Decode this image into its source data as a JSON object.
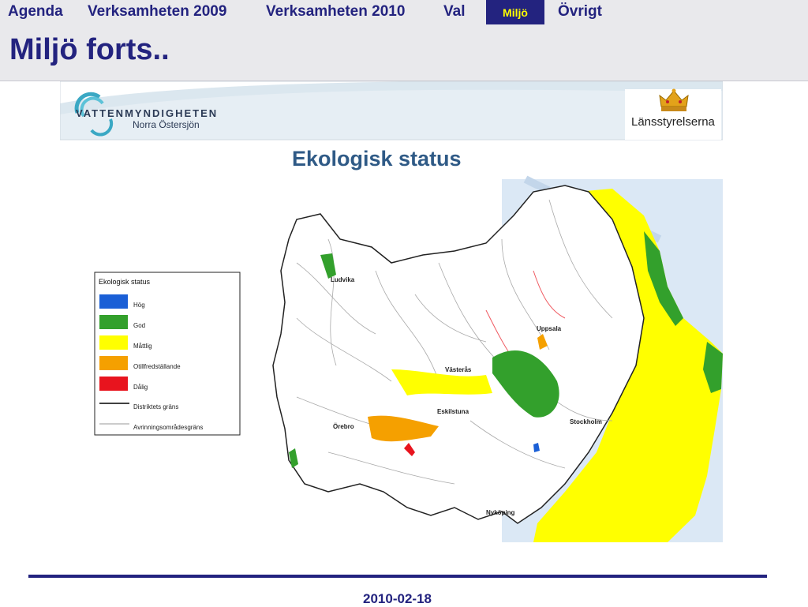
{
  "nav": {
    "items": [
      {
        "label": "Agenda"
      },
      {
        "label": "Verksamheten 2009"
      },
      {
        "label": "Verksamheten 2010"
      },
      {
        "label": "Val"
      },
      {
        "label": "Miljö",
        "active": true
      },
      {
        "label": "Övrigt"
      }
    ]
  },
  "page": {
    "title": "Miljö forts.."
  },
  "slide": {
    "logo_left_line1": "VATTENMYNDIGHETEN",
    "logo_left_line2": "Norra Östersjön",
    "logo_right": "Länsstyrelserna",
    "map_title": "Ekologisk status",
    "legend": {
      "title": "Ekologisk status",
      "items": [
        {
          "label": "Hög",
          "color": "#1a5fd6"
        },
        {
          "label": "God",
          "color": "#33a02c"
        },
        {
          "label": "Måttlig",
          "color": "#ffff00"
        },
        {
          "label": "Otillfredställande",
          "color": "#f5a000"
        },
        {
          "label": "Dålig",
          "color": "#e8141e"
        }
      ],
      "lines": [
        {
          "label": "Distriktets gräns"
        },
        {
          "label": "Avrinningsområdesgräns"
        }
      ]
    },
    "places": [
      {
        "label": "Ludvika"
      },
      {
        "label": "Uppsala"
      },
      {
        "label": "Västerås"
      },
      {
        "label": "Eskilstuna"
      },
      {
        "label": "Stockholm"
      },
      {
        "label": "Örebro"
      },
      {
        "label": "Nyköping"
      }
    ]
  },
  "footer": {
    "date": "2010-02-18"
  },
  "colors": {
    "brand": "#23237f",
    "nav_active_text": "#ffff00",
    "sea": "#dbe8f5"
  }
}
